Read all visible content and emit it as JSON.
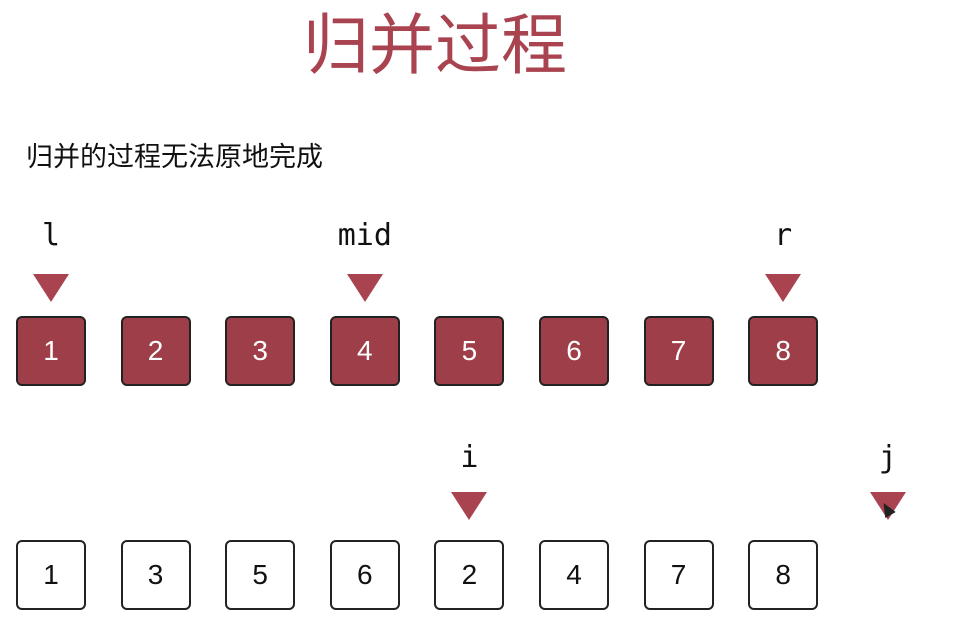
{
  "title": "归并过程",
  "subtitle": "归并的过程无法原地完成",
  "top_row": {
    "values": [
      "1",
      "2",
      "3",
      "4",
      "5",
      "6",
      "7",
      "8"
    ],
    "pointers": [
      {
        "label": "l",
        "index": 0
      },
      {
        "label": "mid",
        "index": 3
      },
      {
        "label": "r",
        "index": 7
      }
    ]
  },
  "bottom_row": {
    "values": [
      "1",
      "3",
      "5",
      "6",
      "2",
      "4",
      "7",
      "8"
    ],
    "pointers": [
      {
        "label": "i",
        "index": 4
      },
      {
        "label": "j",
        "index": 8
      }
    ]
  },
  "colors": {
    "accent": "#a8434f",
    "filled_cell": "#9e3e48"
  }
}
